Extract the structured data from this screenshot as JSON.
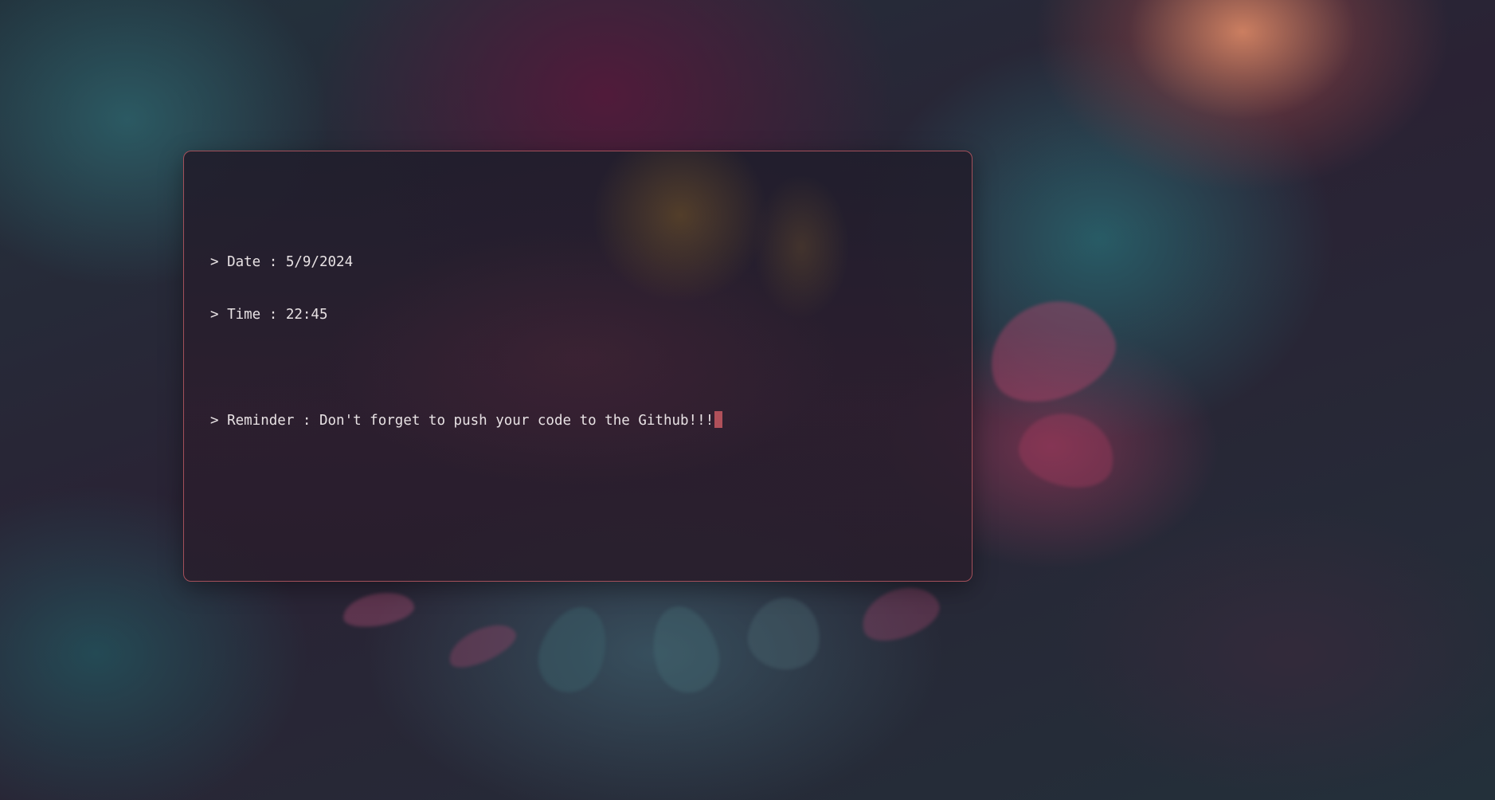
{
  "terminal": {
    "lines": {
      "date": "> Date : 5/9/2024",
      "time": "> Time : 22:45",
      "reminder": "> Reminder : Don't forget to push your code to the Github!!!"
    }
  },
  "colors": {
    "window_border": "#a3505a",
    "text": "#e8e2e4",
    "cursor": "#b0505a"
  }
}
